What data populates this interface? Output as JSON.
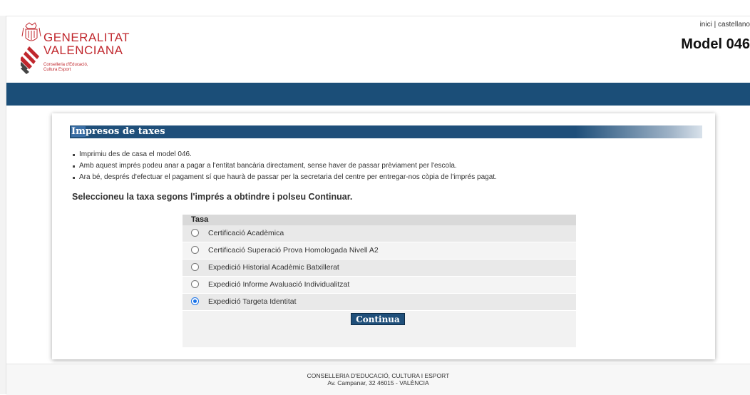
{
  "header": {
    "logo_title_line1": "GENERALITAT",
    "logo_title_line2": "VALENCIANA",
    "logo_sub_line1": "Conselleria d'Educació,",
    "logo_sub_line2": "Cultura  Esport",
    "link_inici": "inici",
    "link_separator": " | ",
    "link_castellano": "castellano",
    "model_title": "Model 046"
  },
  "panel": {
    "title_highlight": "Im",
    "title_rest": "presos de taxes",
    "bullets": [
      "Imprimiu des de casa el model 046.",
      "Amb aquest imprés podeu anar a pagar a l'entitat bancària directament, sense haver de passar prèviament per l'escola.",
      "Ara bé, després d'efectuar el pagament sí que haurà de passar per la secretaria del centre per entregar-nos còpia de l'imprés pagat."
    ],
    "instruction": "Seleccioneu la taxa segons l'imprés a obtindre i polseu Continuar."
  },
  "table": {
    "header": "Tasa",
    "options": [
      {
        "label": "Certificació Acadèmica",
        "checked": false
      },
      {
        "label": "Certificació Superació Prova Homologada Nivell A2",
        "checked": false
      },
      {
        "label": "Expedició Historial Acadèmic Batxillerat",
        "checked": false
      },
      {
        "label": "Expedició Informe Avaluació Individualitzat",
        "checked": false
      },
      {
        "label": "Expedició Targeta Identitat",
        "checked": true
      }
    ],
    "button_label": "Continua"
  },
  "footer": {
    "line1": "CONSELLERIA D'EDUCACIÓ, CULTURA I ESPORT",
    "line2": "Av. Campanar, 32 46015 - VALÈNCIA"
  },
  "colors": {
    "brand_red": "#c0272d",
    "header_blue": "#1b4e78",
    "radio_accent": "#1a73e8"
  }
}
